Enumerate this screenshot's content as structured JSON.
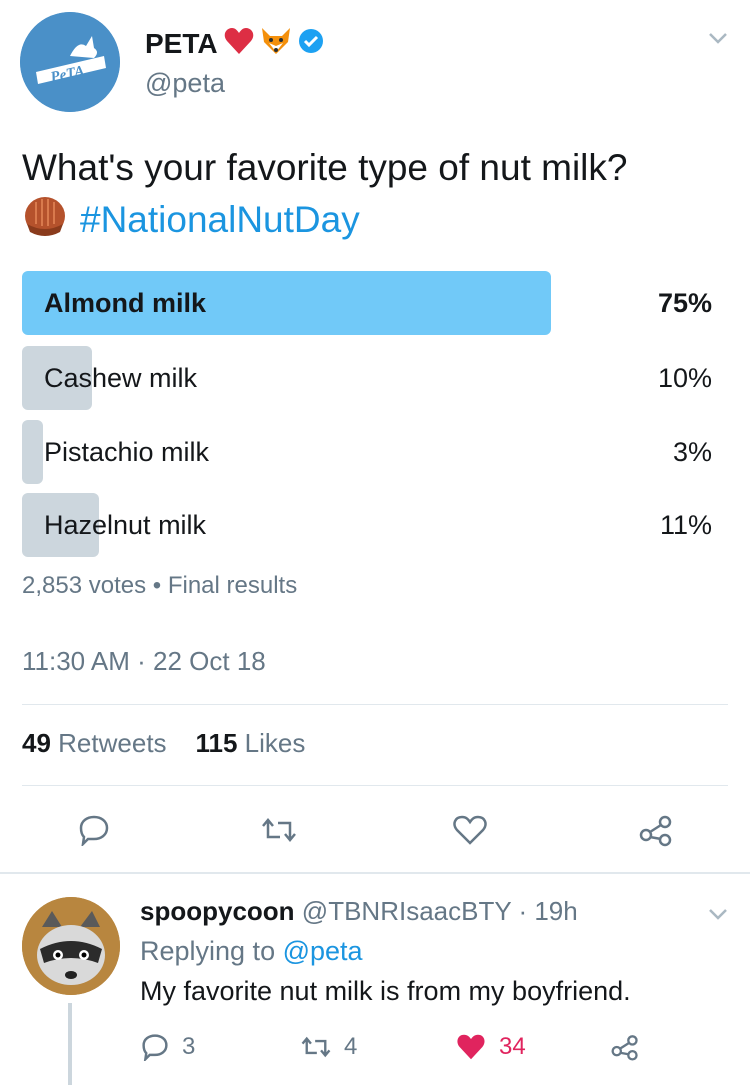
{
  "author": {
    "display_name": "PETA",
    "handle": "@peta",
    "logo_text": "PeTA",
    "emojis": [
      "heart-emoji",
      "fox-emoji"
    ],
    "verified": true
  },
  "tweet": {
    "text": "What's your favorite type of nut milk?",
    "hashtag": "#NationalNutDay",
    "emoji": "chestnut-emoji"
  },
  "poll": {
    "options": [
      {
        "label": "Almond milk",
        "percent_text": "75%",
        "percent": 75,
        "winner": true
      },
      {
        "label": "Cashew milk",
        "percent_text": "10%",
        "percent": 10,
        "winner": false
      },
      {
        "label": "Pistachio milk",
        "percent_text": "3%",
        "percent": 3,
        "winner": false
      },
      {
        "label": "Hazelnut milk",
        "percent_text": "11%",
        "percent": 11,
        "winner": false
      }
    ],
    "votes": "2,853 votes",
    "separator": "•",
    "status": "Final results"
  },
  "timestamp": "11:30 AM · 22 Oct 18",
  "stats": {
    "retweets_count": "49",
    "retweets_label": "Retweets",
    "likes_count": "115",
    "likes_label": "Likes"
  },
  "actions": [
    "reply-icon",
    "retweet-icon",
    "like-icon",
    "share-icon"
  ],
  "reply": {
    "display_name": "spoopycoon",
    "handle": "@TBNRIsaacBTY",
    "time": "· 19h",
    "replying_prefix": "Replying to",
    "replying_to": "@peta",
    "text": "My favorite nut milk is from my boyfriend.",
    "reply_count": "3",
    "retweet_count": "4",
    "like_count": "34",
    "liked": true
  },
  "colors": {
    "accent": "#1b95e0",
    "poll_winner": "#71c9f8",
    "poll_other": "#ccd6dd",
    "like": "#e0245e",
    "muted": "#657786"
  }
}
